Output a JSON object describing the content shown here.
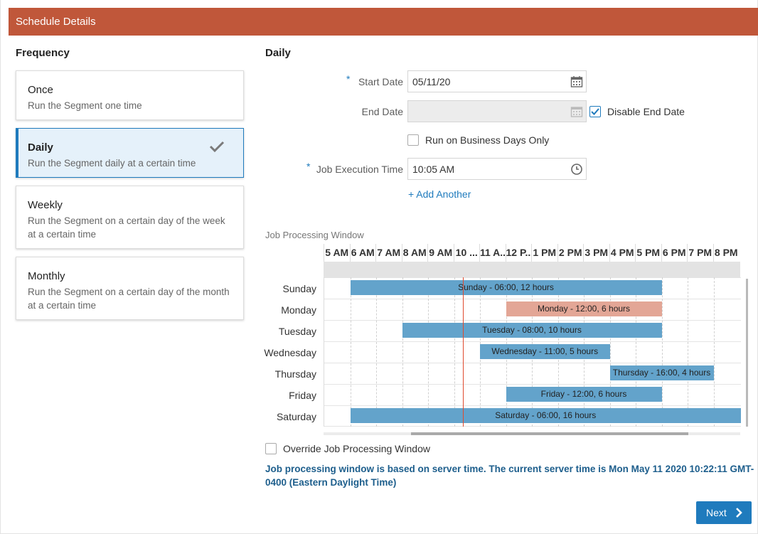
{
  "header": {
    "title": "Schedule Details"
  },
  "frequency": {
    "title": "Frequency",
    "options": [
      {
        "title": "Once",
        "desc": "Run the Segment one time"
      },
      {
        "title": "Daily",
        "desc": "Run the Segment daily at a certain time",
        "selected": true
      },
      {
        "title": "Weekly",
        "desc": "Run the Segment on a certain day of the week at a certain time"
      },
      {
        "title": "Monthly",
        "desc": "Run the Segment on a certain day of the month at a certain time"
      }
    ]
  },
  "daily": {
    "title": "Daily",
    "start_date_label": "Start Date",
    "start_date_value": "05/11/20",
    "end_date_label": "End Date",
    "end_date_value": "",
    "disable_end_date_label": "Disable End Date",
    "disable_end_date_checked": true,
    "business_days_label": "Run on Business Days Only",
    "business_days_checked": false,
    "job_time_label": "Job Execution Time",
    "job_time_value": "10:05 AM",
    "add_another": "+ Add Another",
    "required_mark": "*"
  },
  "window": {
    "label": "Job Processing Window",
    "hours": [
      "5 AM",
      "6 AM",
      "7 AM",
      "8 AM",
      "9 AM",
      "10 ...",
      "11 A...",
      "12 P...",
      "1 PM",
      "2 PM",
      "3 PM",
      "4 PM",
      "5 PM",
      "6 PM",
      "7 PM",
      "8 PM"
    ],
    "days": [
      {
        "day": "Sunday",
        "bar": "Sunday - 06:00, 12 hours",
        "start": 6,
        "duration": 12,
        "color": "#63a3cb"
      },
      {
        "day": "Monday",
        "bar": "Monday - 12:00, 6 hours",
        "start": 12,
        "duration": 6,
        "color": "#e3a696"
      },
      {
        "day": "Tuesday",
        "bar": "Tuesday - 08:00, 10 hours",
        "start": 8,
        "duration": 10,
        "color": "#63a3cb"
      },
      {
        "day": "Wednesday",
        "bar": "Wednesday - 11:00, 5 hours",
        "start": 11,
        "duration": 5,
        "color": "#63a3cb"
      },
      {
        "day": "Thursday",
        "bar": "Thursday - 16:00, 4 hours",
        "start": 16,
        "duration": 4,
        "color": "#63a3cb"
      },
      {
        "day": "Friday",
        "bar": "Friday - 12:00, 6 hours",
        "start": 12,
        "duration": 6,
        "color": "#63a3cb"
      },
      {
        "day": "Saturday",
        "bar": "Saturday - 06:00, 16 hours",
        "start": 6,
        "duration": 16,
        "color": "#63a3cb"
      }
    ],
    "override_label": "Override Job Processing Window",
    "override_checked": false,
    "server_time_note": "Job processing window is based on server time. The current server time is Mon May 11 2020 10:22:11 GMT-0400 (Eastern Daylight Time)"
  },
  "footer": {
    "next_label": "Next"
  },
  "colors": {
    "header": "#c0573a",
    "accent": "#1f7bbd",
    "bar_blue": "#63a3cb",
    "bar_salmon": "#e3a696",
    "now_line": "#e04a2e"
  }
}
